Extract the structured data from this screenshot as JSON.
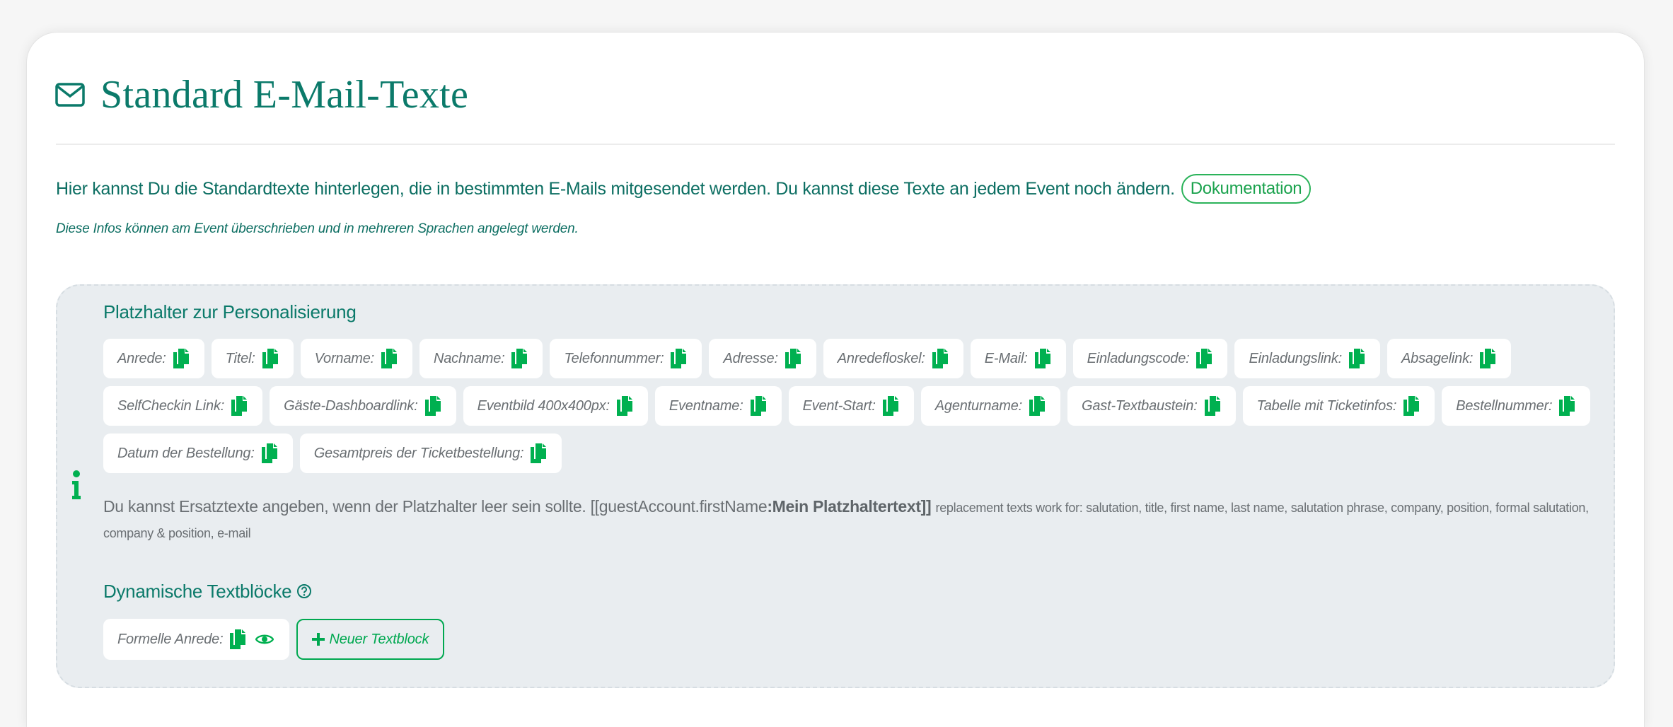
{
  "page": {
    "title": "Standard E-Mail-Texte",
    "title_icon": "envelope-icon"
  },
  "intro": {
    "text": "Hier kannst Du die Standardtexte hinterlegen, die in bestimmten E-Mails mitgesendet werden. Du kannst diese Texte an jedem Event noch ändern.",
    "doc_link": "Dokumentation"
  },
  "note": "Diese Infos können am Event überschrieben und in mehreren Sprachen angelegt werden.",
  "placeholders": {
    "heading": "Platzhalter zur Personalisierung",
    "info_icon": "info-icon",
    "copy_icon": "copy-icon",
    "items": [
      {
        "label": "Anrede:"
      },
      {
        "label": "Titel:"
      },
      {
        "label": "Vorname:"
      },
      {
        "label": "Nachname:"
      },
      {
        "label": "Telefonnummer:"
      },
      {
        "label": "Adresse:"
      },
      {
        "label": "Anredefloskel:"
      },
      {
        "label": "E-Mail:"
      },
      {
        "label": "Einladungscode:"
      },
      {
        "label": "Einladungslink:"
      },
      {
        "label": "Absagelink:"
      },
      {
        "label": "SelfCheckin Link:"
      },
      {
        "label": "Gäste-Dashboardlink:"
      },
      {
        "label": "Eventbild 400x400px:"
      },
      {
        "label": "Eventname:"
      },
      {
        "label": "Event-Start:"
      },
      {
        "label": "Agenturname:"
      },
      {
        "label": "Gast-Textbaustein:"
      },
      {
        "label": "Tabelle mit Ticketinfos:"
      },
      {
        "label": "Bestellnummer:"
      },
      {
        "label": "Datum der Bestellung:"
      },
      {
        "label": "Gesamtpreis der Ticketbestellung:"
      }
    ]
  },
  "replacement": {
    "text": "Du kannst Ersatztexte angeben, wenn der Platzhalter leer sein sollte.",
    "code_prefix": "[[guestAccount.firstName",
    "code_bold": ":Mein Platzhaltertext]]",
    "small": "replacement texts work for: salutation, title, first name, last name, salutation phrase, company, position, formal salutation, company & position, e-mail"
  },
  "dynamic": {
    "heading": "Dynamische Textblöcke",
    "help_icon": "question-circle-icon",
    "preview_icon": "eye-icon",
    "items": [
      {
        "label": "Formelle Anrede:"
      }
    ],
    "new_button": "Neuer Textblock",
    "new_icon": "plus-icon"
  },
  "colors": {
    "heading": "#0b7a6a",
    "accent": "#00b050",
    "info_box_bg": "#e9edf0",
    "muted_text": "#6a6f73"
  }
}
